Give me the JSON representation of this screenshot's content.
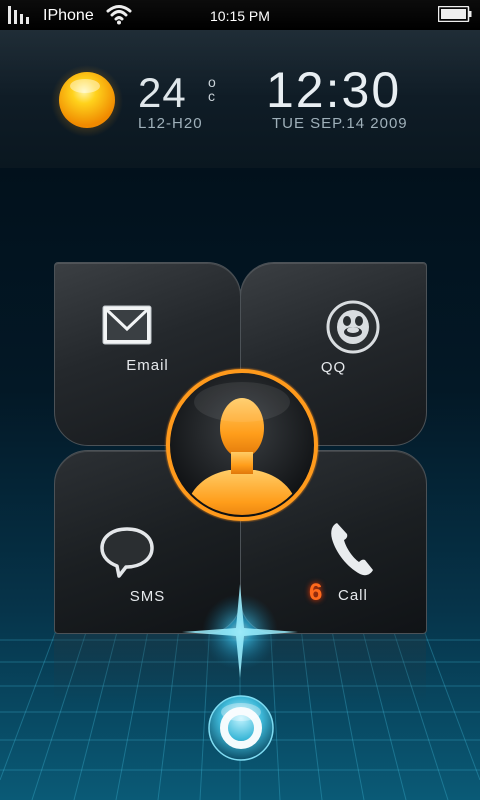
{
  "status_bar": {
    "carrier": "IPhone",
    "time": "10:15 PM"
  },
  "weather": {
    "temperature": "24",
    "degree_symbol": "o",
    "unit": "c",
    "range": "L12-H20",
    "icon": "sun-icon"
  },
  "clock": {
    "time": "12:30",
    "date": "TUE SEP.14 2009"
  },
  "tiles": {
    "email": {
      "label": "Email",
      "icon": "envelope-icon"
    },
    "qq": {
      "label": "QQ",
      "icon": "penguin-icon"
    },
    "sms": {
      "label": "SMS",
      "icon": "speech-bubble-icon"
    },
    "call": {
      "label": "Call",
      "missed_count": "6",
      "icon": "phone-icon"
    }
  },
  "colors": {
    "accent_orange": "#ff9a1c",
    "missed_count": "#ff6a1c",
    "background_teal": "#0a5a76"
  }
}
